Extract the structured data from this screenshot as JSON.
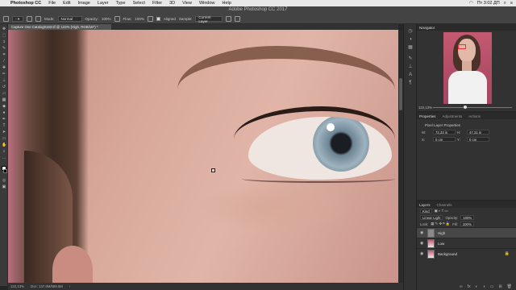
{
  "menubar": {
    "app": "Photoshop CC",
    "items": [
      "File",
      "Edit",
      "Image",
      "Layer",
      "Type",
      "Select",
      "Filter",
      "3D",
      "View",
      "Window",
      "Help"
    ],
    "clock": "Пт 3:02 ДП"
  },
  "window": {
    "title": "Adobe Photoshop CC 2017"
  },
  "options": {
    "mode_label": "Mode:",
    "mode_value": "Normal",
    "opacity_label": "Opacity:",
    "opacity_value": "100%",
    "flow_label": "Flow:",
    "flow_value": "100%",
    "aligned_label": "Aligned",
    "sample_label": "Sample:",
    "sample_value": "Current Layer"
  },
  "document": {
    "tab_title": "Capture One Catalog0183.tif @ 122% (High, RGB/16*) *"
  },
  "status": {
    "zoom": "122,13%",
    "doc_info": "Doc: 137,9M/689,6M"
  },
  "navigator": {
    "title": "Navigator",
    "zoom": "122,13%"
  },
  "properties": {
    "tabs": [
      "Properties",
      "Adjustments",
      "Actions"
    ],
    "subtitle": "Pixel Layer Properties",
    "w_label": "W:",
    "w_value": "72,33 in",
    "h_label": "H:",
    "h_value": "47,31 in",
    "x_label": "X:",
    "x_value": "0 cm",
    "y_label": "Y:",
    "y_value": "0 cm"
  },
  "layers": {
    "tabs": [
      "Layers",
      "Channels"
    ],
    "kind": "Kind",
    "blend": "Linear Light",
    "opacity_label": "Opacity:",
    "opacity_value": "100%",
    "lock_label": "Lock:",
    "fill_label": "Fill:",
    "fill_value": "100%",
    "items": [
      {
        "name": "High"
      },
      {
        "name": "Low"
      },
      {
        "name": "Background"
      }
    ]
  },
  "colors": {
    "ps_dark": "#323232",
    "ps_panel": "#434343",
    "nav_box": "#ff2b2b"
  }
}
